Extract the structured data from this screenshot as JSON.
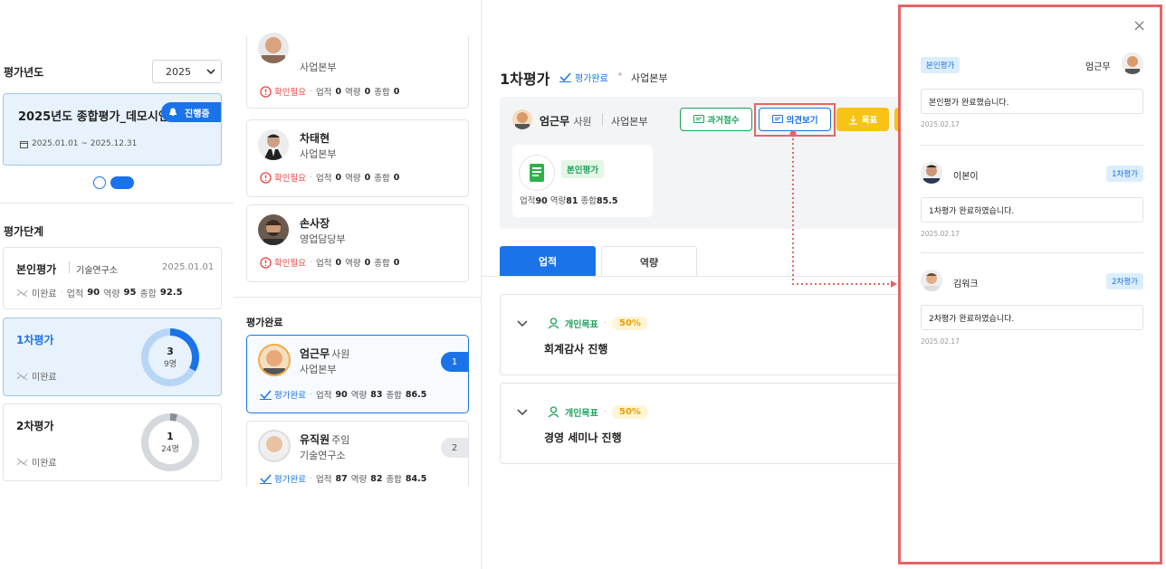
{
  "left": {
    "year_label": "평가년도",
    "year_value": "2025",
    "eval_title": "2025년도 종합평가_데모시연",
    "eval_status": "진행중",
    "eval_period": "2025.01.01 ~ 2025.12.31",
    "stage_label": "평가단계",
    "self_eval": {
      "name": "본인평가",
      "dept": "기술연구소",
      "date": "2025.01.01",
      "status": "미완료",
      "scores": [
        "업적",
        "90",
        "역량",
        "95",
        "종합",
        "92.5"
      ]
    },
    "first_eval": {
      "name": "1차평가",
      "status": "미완료",
      "count": "3",
      "total": "9명",
      "progress": 0.33
    },
    "second_eval": {
      "name": "2차평가",
      "status": "미완료",
      "count": "1",
      "total": "24명",
      "progress": 0.04
    }
  },
  "middle": {
    "pending": [
      {
        "name": "",
        "dept": "사업본부",
        "status": "확인필요",
        "scores": [
          "업적",
          "0",
          "역량",
          "0",
          "종합",
          "0"
        ]
      },
      {
        "name": "차태현",
        "dept": "사업본부",
        "status": "확인필요",
        "scores": [
          "업적",
          "0",
          "역량",
          "0",
          "종합",
          "0"
        ]
      },
      {
        "name": "손사장",
        "dept": "영업담당부",
        "status": "확인필요",
        "scores": [
          "업적",
          "0",
          "역량",
          "0",
          "종합",
          "0"
        ]
      }
    ],
    "completed_label": "평가완료",
    "completed": [
      {
        "name": "엄근무",
        "pos": "사원",
        "dept": "사업본부",
        "status": "평가완료",
        "num": "1",
        "scores": [
          "업적",
          "90",
          "역량",
          "83",
          "종합",
          "86.5"
        ]
      },
      {
        "name": "유직원",
        "pos": "주임",
        "dept": "기술연구소",
        "status": "평가완료",
        "num": "2",
        "scores": [
          "업적",
          "87",
          "역량",
          "82",
          "종합",
          "84.5"
        ]
      }
    ]
  },
  "main": {
    "title": "1차평가",
    "status": "평가완료",
    "dept": "사업본부",
    "person": {
      "name": "엄근무",
      "pos": "사원",
      "dept": "사업본부"
    },
    "btn_past": "과거점수",
    "btn_opinion": "의견보기",
    "btn_goal": "목표",
    "self_card": {
      "tag": "본인평가",
      "scores": [
        "업적",
        "90",
        "역량",
        "81",
        "종합",
        "85.5"
      ]
    },
    "tabs": [
      "업적",
      "역량"
    ],
    "goals": [
      {
        "type": "개인목표",
        "pct": "50%",
        "title": "회계감사 진행"
      },
      {
        "type": "개인목표",
        "pct": "50%",
        "title": "경영 세미나 진행"
      }
    ]
  },
  "panel": {
    "close": "×",
    "opinions": [
      {
        "tag": "본인평가",
        "name": "엄근무",
        "msg": "본인평가 완료했습니다.",
        "date": "2025.02.17"
      },
      {
        "tag": "1차평가",
        "name": "이본이",
        "msg": "1차평가 완료하였습니다.",
        "date": "2025.02.17"
      },
      {
        "tag": "2차평가",
        "name": "김워크",
        "msg": "2차평가 완료하였습니다.",
        "date": "2025.02.17"
      }
    ]
  },
  "colors": {
    "accent": "#1a73e8",
    "highlight": "#e76565",
    "warn": "#e44444",
    "green": "#1aa35b",
    "yellow": "#f7c315"
  }
}
